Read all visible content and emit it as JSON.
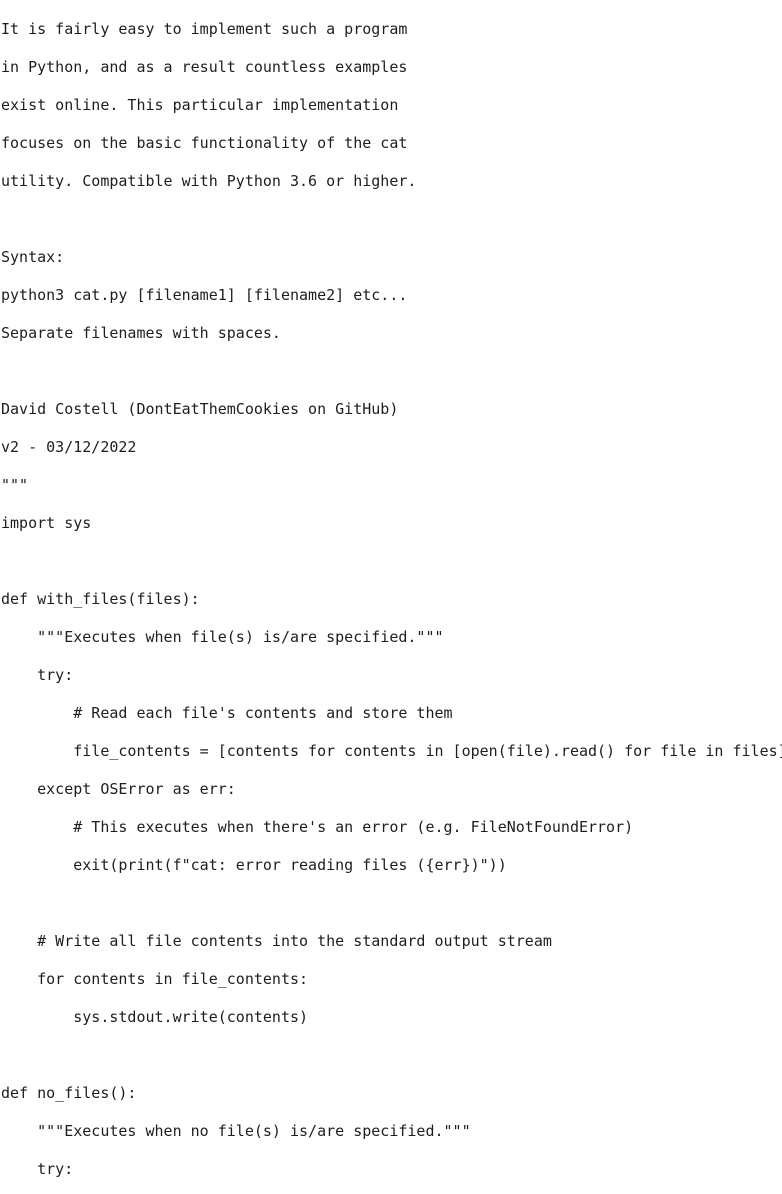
{
  "code_view": {
    "lines": [
      "It is fairly easy to implement such a program",
      "in Python, and as a result countless examples",
      "exist online. This particular implementation",
      "focuses on the basic functionality of the cat",
      "utility. Compatible with Python 3.6 or higher.",
      "",
      "Syntax:",
      "python3 cat.py [filename1] [filename2] etc...",
      "Separate filenames with spaces.",
      "",
      "David Costell (DontEatThemCookies on GitHub)",
      "v2 - 03/12/2022",
      "\"\"\"",
      "import sys",
      "",
      "def with_files(files):",
      "    \"\"\"Executes when file(s) is/are specified.\"\"\"",
      "    try:",
      "        # Read each file's contents and store them",
      "        file_contents = [contents for contents in [open(file).read() for file in files]]",
      "    except OSError as err:",
      "        # This executes when there's an error (e.g. FileNotFoundError)",
      "        exit(print(f\"cat: error reading files ({err})\"))",
      "",
      "    # Write all file contents into the standard output stream",
      "    for contents in file_contents:",
      "        sys.stdout.write(contents)",
      "",
      "def no_files():",
      "    \"\"\"Executes when no file(s) is/are specified.\"\"\"",
      "    try:"
    ]
  }
}
